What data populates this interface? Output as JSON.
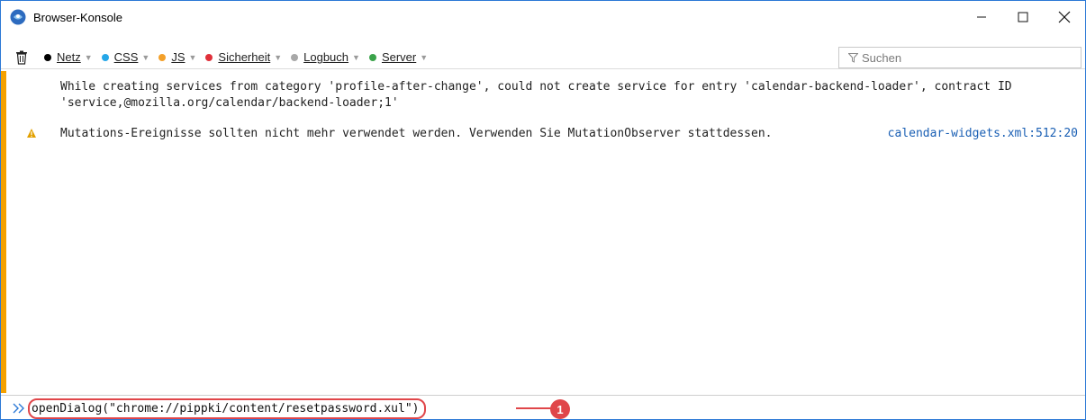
{
  "window": {
    "title": "Browser-Konsole"
  },
  "toolbar": {
    "filters": [
      {
        "label": "Netz",
        "color": "#000000"
      },
      {
        "label": "CSS",
        "color": "#25a7e8"
      },
      {
        "label": "JS",
        "color": "#f3a02a"
      },
      {
        "label": "Sicherheit",
        "color": "#e0303a"
      },
      {
        "label": "Logbuch",
        "color": "#a8a8a8"
      },
      {
        "label": "Server",
        "color": "#3aa34a"
      }
    ],
    "search_placeholder": "Suchen"
  },
  "log": {
    "entries": [
      {
        "type": "error",
        "message": "While creating services from category 'profile-after-change', could not create service for entry 'calendar-backend-loader', contract ID 'service,@mozilla.org/calendar/backend-loader;1'",
        "source": ""
      },
      {
        "type": "warning",
        "message": "Mutations-Ereignisse sollten nicht mehr verwendet werden. Verwenden Sie MutationObserver stattdessen.",
        "source": "calendar-widgets.xml:512:20"
      }
    ]
  },
  "input": {
    "command": "openDialog(\"chrome://pippki/content/resetpassword.xul\")"
  },
  "annotation": {
    "badge": "1",
    "color": "#e0464a"
  }
}
